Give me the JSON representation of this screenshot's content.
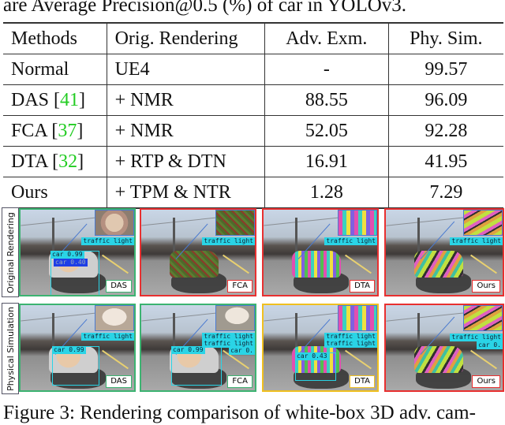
{
  "top_caption": "are Average Precision@0.5 (%) of car in YOLOv3.",
  "table": {
    "headers": [
      "Methods",
      "Orig. Rendering",
      "Adv. Exm.",
      "Phy. Sim."
    ],
    "rows": [
      {
        "method": "Normal",
        "cite": "",
        "rendering": "UE4",
        "adv": "-",
        "phy": "99.57",
        "bold": false
      },
      {
        "method": "DAS [",
        "cite": "41",
        "rendering": "+ NMR",
        "adv": "88.55",
        "phy": "96.09",
        "bold": false
      },
      {
        "method": "FCA [",
        "cite": "37",
        "rendering": "+ NMR",
        "adv": "52.05",
        "phy": "92.28",
        "bold": false
      },
      {
        "method": "DTA [",
        "cite": "32",
        "rendering": "+ RTP & DTN",
        "adv": "16.91",
        "phy": "41.95",
        "bold": false
      },
      {
        "method": "Ours",
        "cite": "",
        "rendering": "+ TPM & NTR",
        "adv": "1.28",
        "phy": "7.29",
        "bold": true
      }
    ],
    "cite_close": "]",
    "cite_color": "#22cc22"
  },
  "figure": {
    "row_labels": [
      "Original Rendering",
      "Physical Simulation"
    ],
    "rows": [
      [
        {
          "tag": "DAS",
          "border": "green",
          "detections": [
            "car 0.99",
            "car 0.40",
            "traffic light"
          ]
        },
        {
          "tag": "FCA",
          "border": "red",
          "detections": [
            "traffic light"
          ]
        },
        {
          "tag": "DTA",
          "border": "red",
          "detections": [
            "traffic light"
          ]
        },
        {
          "tag": "Ours",
          "border": "red",
          "detections": [
            "traffic light"
          ]
        }
      ],
      [
        {
          "tag": "DAS",
          "border": "green",
          "detections": [
            "car 0.99",
            "traffic light"
          ]
        },
        {
          "tag": "FCA",
          "border": "green",
          "detections": [
            "car 0.99",
            "traffic light",
            "traffic light",
            "car 0."
          ]
        },
        {
          "tag": "DTA",
          "border": "yellow",
          "detections": [
            "car 0.43",
            "traffic light",
            "traffic light"
          ]
        },
        {
          "tag": "Ours",
          "border": "red",
          "detections": [
            "traffic light",
            "car 0."
          ]
        }
      ]
    ],
    "border_colors": {
      "green": "#3cb371",
      "red": "#e83030",
      "yellow": "#f0c020"
    }
  },
  "bottom_caption": "Figure 3: Rendering comparison of white-box 3D adv. cam-"
}
